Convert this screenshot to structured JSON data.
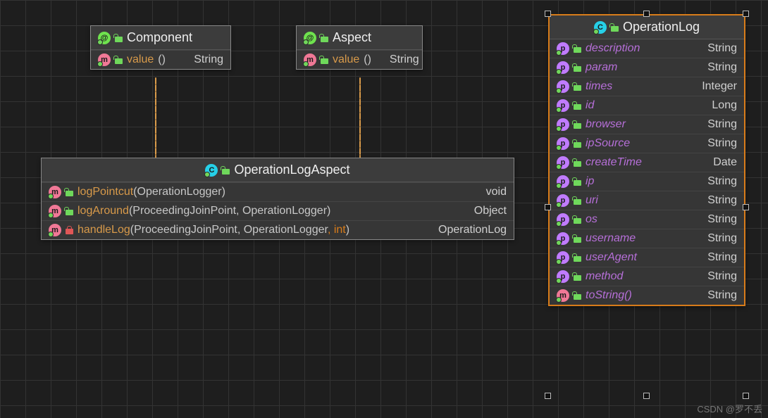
{
  "boxes": {
    "component": {
      "title": "Component",
      "rows": [
        {
          "kind": "method",
          "vis": "open-green",
          "name": "value",
          "sig": "()",
          "ret": "String",
          "style": "orange"
        }
      ]
    },
    "aspect": {
      "title": "Aspect",
      "rows": [
        {
          "kind": "method",
          "vis": "open-green",
          "name": "value",
          "sig": "()",
          "ret": "String",
          "style": "orange"
        }
      ]
    },
    "ola": {
      "title": "OperationLogAspect",
      "rows": [
        {
          "kind": "method",
          "vis": "open-green",
          "name": "logPointcut",
          "sig_pre": "(OperationLogger)",
          "ret": "void",
          "retStyle": "ret-void",
          "style": "orange"
        },
        {
          "kind": "method",
          "vis": "open-green",
          "name": "logAround",
          "sig_pre": "(ProceedingJoinPoint, OperationLogger)",
          "ret": "Object",
          "style": "orange"
        },
        {
          "kind": "method",
          "vis": "closed-red",
          "name": "handleLog",
          "sig_pre": "(ProceedingJoinPoint, OperationLogger",
          "kw": ", int",
          "sig_post": ")",
          "ret": "OperationLog",
          "style": "orange"
        }
      ]
    },
    "olog": {
      "title": "OperationLog",
      "rows": [
        {
          "kind": "prop",
          "vis": "open-green",
          "name": "description",
          "ret": "String",
          "style": "purple"
        },
        {
          "kind": "prop",
          "vis": "open-green",
          "name": "param",
          "ret": "String",
          "style": "purple"
        },
        {
          "kind": "prop",
          "vis": "open-green",
          "name": "times",
          "ret": "Integer",
          "style": "purple"
        },
        {
          "kind": "prop",
          "vis": "open-green",
          "name": "id",
          "ret": "Long",
          "style": "purple"
        },
        {
          "kind": "prop",
          "vis": "open-green",
          "name": "browser",
          "ret": "String",
          "style": "purple"
        },
        {
          "kind": "prop",
          "vis": "open-green",
          "name": "ipSource",
          "ret": "String",
          "style": "purple"
        },
        {
          "kind": "prop",
          "vis": "open-green",
          "name": "createTime",
          "ret": "Date",
          "style": "purple"
        },
        {
          "kind": "prop",
          "vis": "open-green",
          "name": "ip",
          "ret": "String",
          "style": "purple"
        },
        {
          "kind": "prop",
          "vis": "open-green",
          "name": "uri",
          "ret": "String",
          "style": "purple"
        },
        {
          "kind": "prop",
          "vis": "open-green",
          "name": "os",
          "ret": "String",
          "style": "purple"
        },
        {
          "kind": "prop",
          "vis": "open-green",
          "name": "username",
          "ret": "String",
          "style": "purple"
        },
        {
          "kind": "prop",
          "vis": "open-green",
          "name": "userAgent",
          "ret": "String",
          "style": "purple"
        },
        {
          "kind": "prop",
          "vis": "open-green",
          "name": "method",
          "ret": "String",
          "style": "purple"
        },
        {
          "kind": "method",
          "vis": "open-green",
          "name": "toString",
          "sig": "()",
          "ret": "String",
          "style": "purple"
        }
      ]
    }
  },
  "watermark": "CSDN @罗不丢"
}
